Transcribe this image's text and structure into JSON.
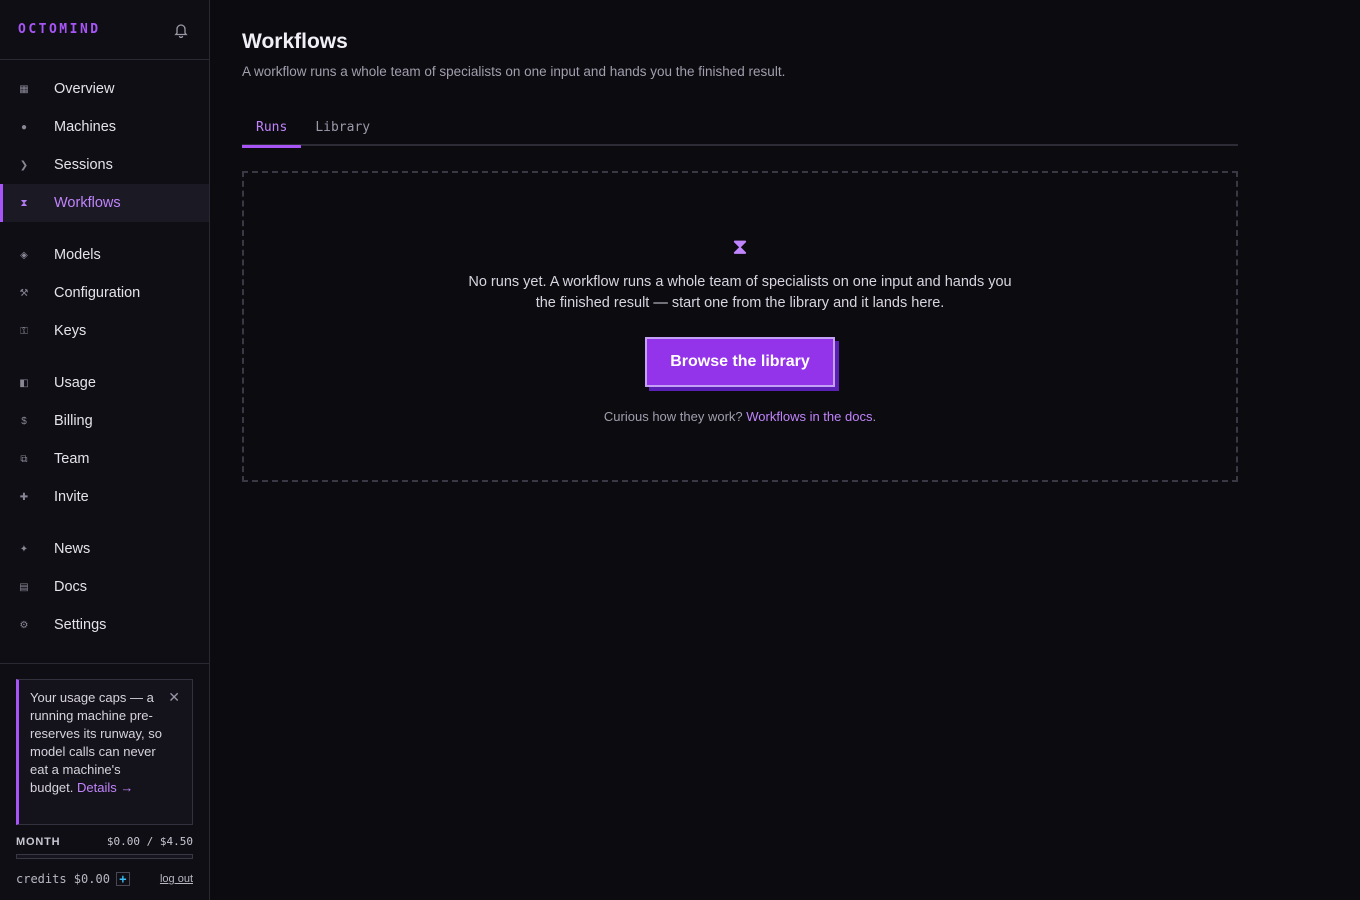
{
  "brand": "OCTOMIND",
  "nav": {
    "groups": [
      [
        {
          "label": "Overview",
          "icon": "▦"
        },
        {
          "label": "Machines",
          "icon": "●"
        },
        {
          "label": "Sessions",
          "icon": "❯"
        },
        {
          "label": "Workflows",
          "icon": "⧗",
          "active": true
        }
      ],
      [
        {
          "label": "Models",
          "icon": "◈"
        },
        {
          "label": "Configuration",
          "icon": "⚒"
        },
        {
          "label": "Keys",
          "icon": "⚿"
        }
      ],
      [
        {
          "label": "Usage",
          "icon": "◧"
        },
        {
          "label": "Billing",
          "icon": "$"
        },
        {
          "label": "Team",
          "icon": "⧉"
        },
        {
          "label": "Invite",
          "icon": "✚"
        }
      ],
      [
        {
          "label": "News",
          "icon": "✦"
        },
        {
          "label": "Docs",
          "icon": "▤"
        },
        {
          "label": "Settings",
          "icon": "⚙"
        }
      ]
    ]
  },
  "tip": {
    "text": "Your usage caps — a running machine pre-reserves its runway, so model calls can never eat a machine's budget.",
    "link": "Details →",
    "close": "✕"
  },
  "usage": {
    "label": "MONTH",
    "value": "$0.00 / $4.50",
    "progress": 0
  },
  "credits": {
    "text": "credits $0.00",
    "plus": "+",
    "logout": "log out"
  },
  "page": {
    "title": "Workflows",
    "subtitle": "A workflow runs a whole team of specialists on one input and hands you the finished result."
  },
  "tabs": [
    {
      "label": "Runs",
      "active": true
    },
    {
      "label": "Library",
      "active": false
    }
  ],
  "empty": {
    "icon": "⧗",
    "text": "No runs yet. A workflow runs a whole team of specialists on one input and hands you the finished result — start one from the library and it lands here.",
    "button": "Browse the library",
    "docs_prefix": "Curious how they work? ",
    "docs_link": "Workflows in the docs",
    "docs_suffix": "."
  },
  "colors": {
    "accent": "#a855f7",
    "background": "#0c0b10",
    "sidebar": "#0f0e14"
  }
}
